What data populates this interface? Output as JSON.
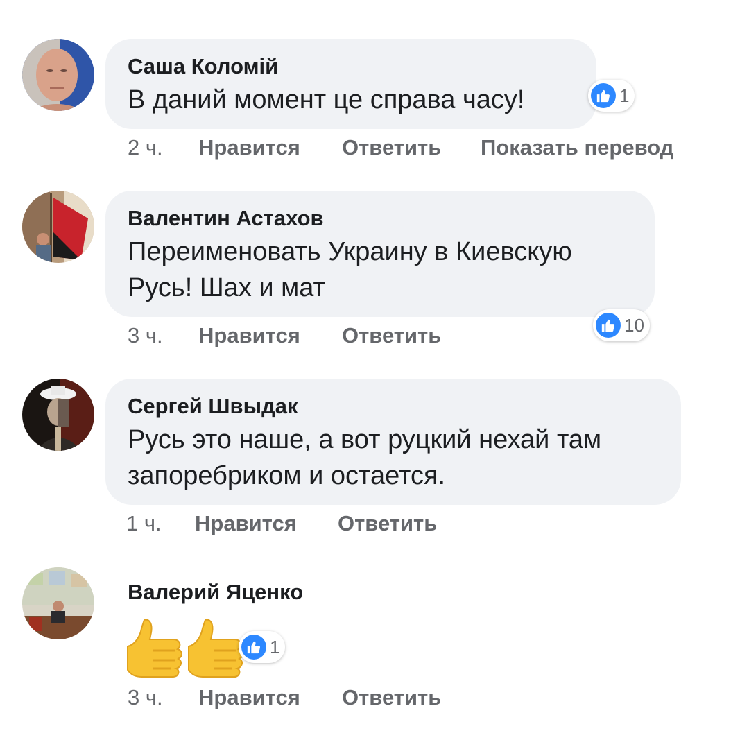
{
  "comments": [
    {
      "author": "Саша Коломій",
      "text": "В даний момент це справа часу!",
      "time": "2 ч.",
      "like_label": "Нравится",
      "reply_label": "Ответить",
      "translate_label": "Показать перевод",
      "reactions": "1",
      "reaction_icon": "thumbs-up-icon"
    },
    {
      "author": "Валентин Астахов",
      "text_line1": "Переименовать Украину в Киевскую",
      "text_line2": "Русь! Шах и мат",
      "time": "3 ч.",
      "like_label": "Нравится",
      "reply_label": "Ответить",
      "reactions": "10",
      "reaction_icon": "thumbs-up-icon"
    },
    {
      "author": "Сергей Швыдак",
      "text_line1": "Русь это наше, а вот руцкий нехай там",
      "text_line2": "запоребриком и остается.",
      "time": "1 ч.",
      "like_label": "Нравится",
      "reply_label": "Ответить"
    },
    {
      "author": "Валерий Яценко",
      "content_icons": [
        "thumbs-up-emoji",
        "thumbs-up-emoji"
      ],
      "time": "3 ч.",
      "like_label": "Нравится",
      "reply_label": "Ответить",
      "reactions": "1",
      "reaction_icon": "thumbs-up-icon"
    }
  ],
  "colors": {
    "bubble": "#f0f2f5",
    "action_text": "#65676b",
    "like_blue": "#2d88ff"
  }
}
